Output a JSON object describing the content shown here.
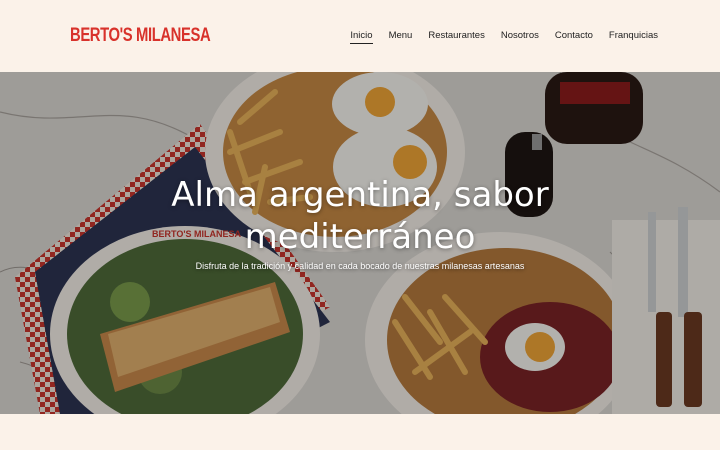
{
  "brand": {
    "name": "BERTO'S MILANESA",
    "plate_text": "BERTO'S MILANESA"
  },
  "nav": {
    "items": [
      {
        "label": "Inicio",
        "active": true
      },
      {
        "label": "Menu"
      },
      {
        "label": "Restaurantes"
      },
      {
        "label": "Nosotros"
      },
      {
        "label": "Contacto"
      },
      {
        "label": "Franquicias"
      }
    ]
  },
  "hero": {
    "title_line1": "Alma argentina, sabor",
    "title_line2": "mediterráneo",
    "subtitle": "Disfruta de la tradición y calidad en cada bocado de nuestras milanesas artesanas"
  },
  "colors": {
    "brand_red": "#d8322b",
    "cream": "#fbf2e9"
  }
}
